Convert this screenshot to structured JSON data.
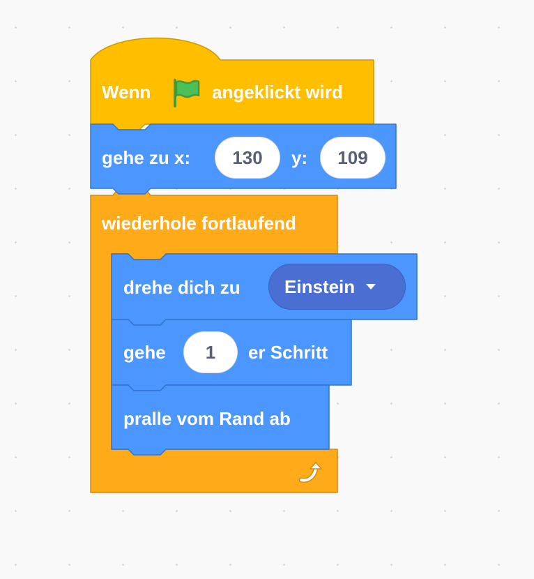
{
  "hat_block": {
    "label_before": "Wenn",
    "flag_icon": "green-flag-icon",
    "label_after": "angeklickt wird"
  },
  "goto_block": {
    "label_x": "gehe zu x:",
    "x_value": "130",
    "label_y": "y:",
    "y_value": "109"
  },
  "forever_block": {
    "label": "wiederhole fortlaufend",
    "loop_icon": "loop-arrow-icon"
  },
  "point_towards_block": {
    "label": "drehe dich zu",
    "target_value": "Einstein"
  },
  "move_block": {
    "label_before": "gehe",
    "steps_value": "1",
    "label_after": "er Schritt"
  },
  "bounce_block": {
    "label": "pralle vom Rand ab"
  },
  "colors": {
    "events": "#ffbf00",
    "motion": "#4c97ff",
    "control": "#ffab19"
  }
}
